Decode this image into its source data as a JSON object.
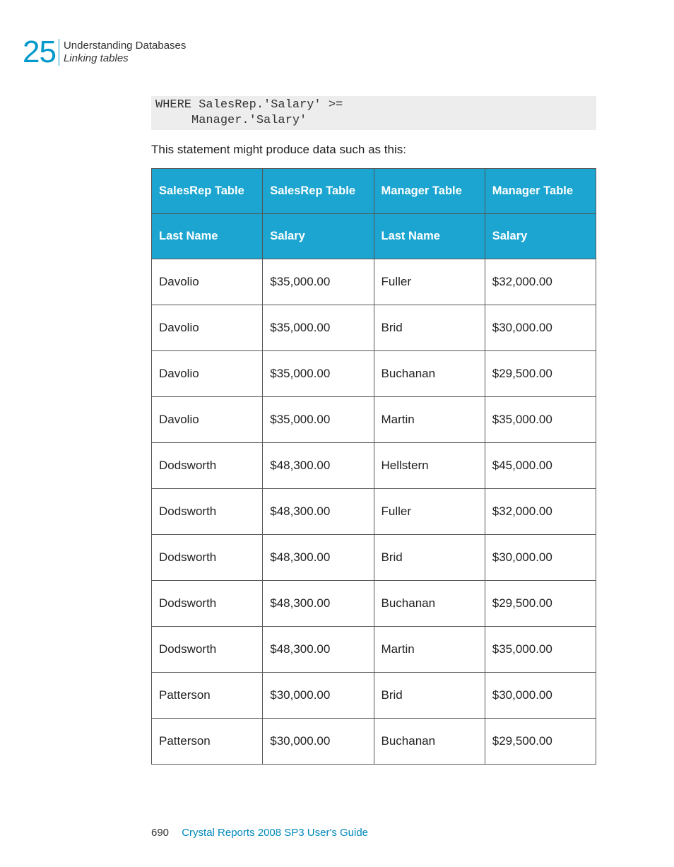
{
  "header": {
    "chapter_number": "25",
    "chapter_title": "Understanding Databases",
    "section_title": "Linking tables"
  },
  "code": "WHERE SalesRep.'Salary' >=\n     Manager.'Salary'",
  "intro_text": "This statement might produce data such as this:",
  "table": {
    "header_row1": [
      "SalesRep Table",
      "SalesRep Table",
      "Manager Table",
      "Manager Table"
    ],
    "header_row2": [
      "Last Name",
      "Salary",
      "Last Name",
      "Salary"
    ],
    "rows": [
      [
        "Davolio",
        "$35,000.00",
        "Fuller",
        "$32,000.00"
      ],
      [
        "Davolio",
        "$35,000.00",
        "Brid",
        "$30,000.00"
      ],
      [
        "Davolio",
        "$35,000.00",
        "Buchanan",
        "$29,500.00"
      ],
      [
        "Davolio",
        "$35,000.00",
        "Martin",
        "$35,000.00"
      ],
      [
        "Dodsworth",
        "$48,300.00",
        "Hellstern",
        "$45,000.00"
      ],
      [
        "Dodsworth",
        "$48,300.00",
        "Fuller",
        "$32,000.00"
      ],
      [
        "Dodsworth",
        "$48,300.00",
        "Brid",
        "$30,000.00"
      ],
      [
        "Dodsworth",
        "$48,300.00",
        "Buchanan",
        "$29,500.00"
      ],
      [
        "Dodsworth",
        "$48,300.00",
        "Martin",
        "$35,000.00"
      ],
      [
        "Patterson",
        "$30,000.00",
        "Brid",
        "$30,000.00"
      ],
      [
        "Patterson",
        "$30,000.00",
        "Buchanan",
        "$29,500.00"
      ]
    ]
  },
  "footer": {
    "page_number": "690",
    "guide_title": "Crystal Reports 2008 SP3 User's Guide"
  }
}
